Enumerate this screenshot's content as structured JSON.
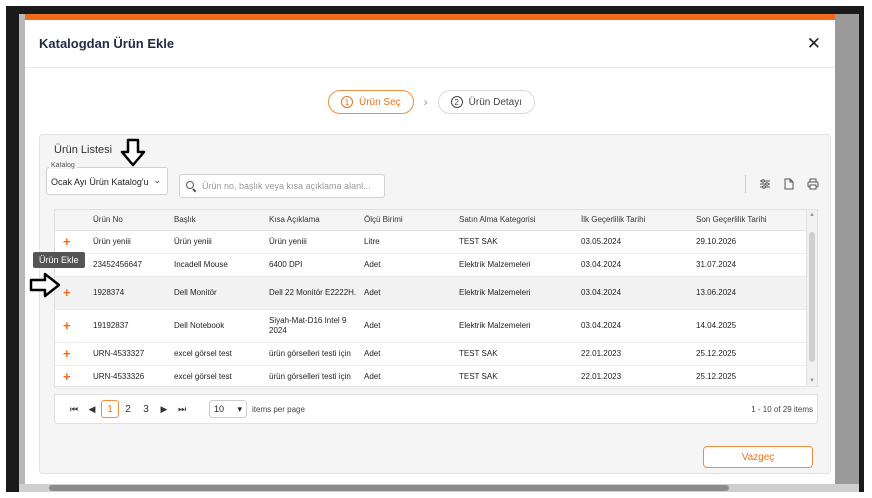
{
  "modal": {
    "title": "Katalogdan Ürün Ekle",
    "close_icon": "close-icon"
  },
  "stepper": {
    "steps": [
      {
        "num": "1",
        "label": "Ürün Seç",
        "active": true
      },
      {
        "num": "2",
        "label": "Ürün Detayı",
        "active": false
      }
    ]
  },
  "panel": {
    "title": "Ürün Listesi",
    "catalog_label": "Katalog",
    "catalog_value": "Ocak Ayı Ürün Katalog'u",
    "search_placeholder": "Ürün no, başlık veya kısa açıklama alanl..."
  },
  "table": {
    "headers": [
      "Ürün No",
      "Başlık",
      "Kısa Açıklama",
      "Ölçü Birimi",
      "Satın Alma Kategorisi",
      "İlk Geçerlilik Tarihi",
      "Son Geçerlilik Tarihi"
    ],
    "rows": [
      [
        "Ürün yeniii",
        "Ürün yeniii",
        "Ürün yeniii",
        "Litre",
        "TEST SAK",
        "03.05.2024",
        "29.10.2026"
      ],
      [
        "23452456647",
        "Incadell Mouse",
        "6400 DPI",
        "Adet",
        "Elektrik Malzemeleri",
        "03.04.2024",
        "31.07.2024"
      ],
      [
        "1928374",
        "Dell Monitör",
        "Dell 22 Monitör E2222H.",
        "Adet",
        "Elektrik Malzemeleri",
        "03.04.2024",
        "13.06.2024"
      ],
      [
        "19192837",
        "Dell Notebook",
        "Siyah-Mat-D16 Intel 9 2024",
        "Adet",
        "Elektrik Malzemeleri",
        "03.04.2024",
        "14.04.2025"
      ],
      [
        "URN-4533327",
        "excel görsel test",
        "ürün görselleri testi için",
        "Adet",
        "TEST SAK",
        "22.01.2023",
        "25.12.2025"
      ],
      [
        "URN-4533326",
        "excel görsel test",
        "ürün görselleri testi için",
        "Adet",
        "TEST SAK",
        "22.01.2023",
        "25.12.2025"
      ]
    ],
    "add_symbol": "+"
  },
  "pager": {
    "first": "⏮",
    "prev": "◀",
    "pages": [
      "1",
      "2",
      "3"
    ],
    "next": "▶",
    "last": "⏭",
    "per_page": "10",
    "per_page_label": "items per page",
    "range": "1 - 10 of 29 items"
  },
  "footer": {
    "cancel_label": "Vazgeç"
  },
  "tooltip": {
    "text": "Ürün Ekle"
  },
  "accent_color": "#f26b1d"
}
